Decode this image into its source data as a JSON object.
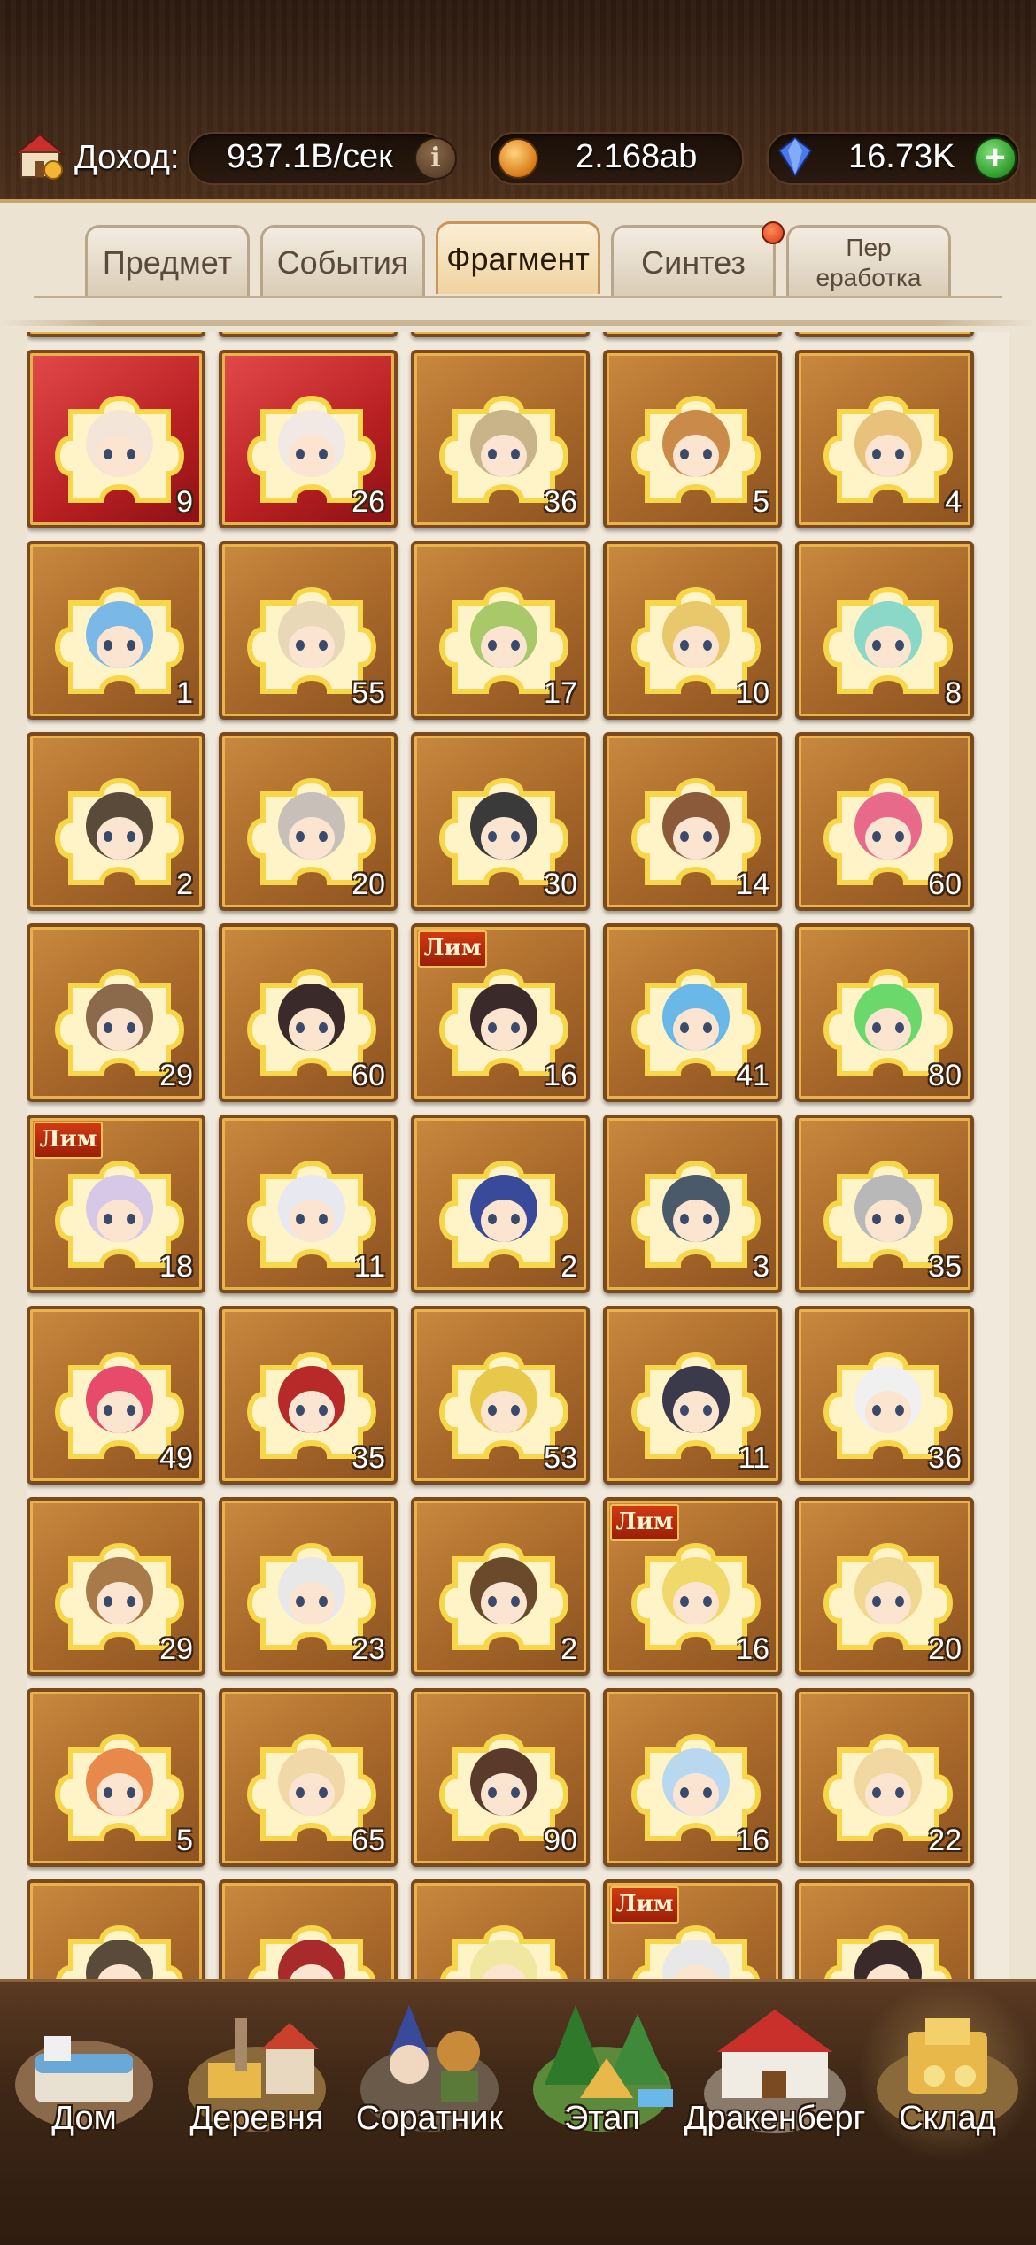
{
  "header": {
    "income_label": "Доход:",
    "income_value": "937.1B/сек",
    "coins_value": "2.168ab",
    "gems_value": "16.73K",
    "house_icon": "house-icon",
    "info_icon": "info-icon",
    "coin_icon": "coin-icon",
    "gem_icon": "gem-icon",
    "plus_icon": "plus-icon"
  },
  "tabs": [
    {
      "label": "Предмет"
    },
    {
      "label": "События"
    },
    {
      "label": "Фрагмент"
    },
    {
      "label": "Синтез"
    },
    {
      "label": "Пер\nеработка"
    }
  ],
  "active_tab": "Фрагмент",
  "lim_label": "Лим",
  "fragments": [
    {
      "count": "9",
      "bg": "red",
      "hue": "#f3e6d8"
    },
    {
      "count": "26",
      "bg": "red",
      "hue": "#f2e9e4"
    },
    {
      "count": "36",
      "bg": "gold",
      "hue": "#c9b48a"
    },
    {
      "count": "5",
      "bg": "gold",
      "hue": "#c98a4a"
    },
    {
      "count": "4",
      "bg": "gold",
      "hue": "#e8c27a"
    },
    {
      "count": "1",
      "bg": "gold",
      "hue": "#7ab8e8"
    },
    {
      "count": "55",
      "bg": "gold",
      "hue": "#e8d8b8"
    },
    {
      "count": "17",
      "bg": "gold",
      "hue": "#a8c86a"
    },
    {
      "count": "10",
      "bg": "gold",
      "hue": "#e8c86a"
    },
    {
      "count": "8",
      "bg": "gold",
      "hue": "#8ad8c8"
    },
    {
      "count": "2",
      "bg": "gold",
      "hue": "#5a4a3a"
    },
    {
      "count": "20",
      "bg": "gold",
      "hue": "#c8c0b8"
    },
    {
      "count": "30",
      "bg": "gold",
      "hue": "#3a3a3a"
    },
    {
      "count": "14",
      "bg": "gold",
      "hue": "#8a5a3a"
    },
    {
      "count": "60",
      "bg": "gold",
      "hue": "#e86a8a"
    },
    {
      "count": "29",
      "bg": "gold",
      "hue": "#8a6a4a"
    },
    {
      "count": "60",
      "bg": "gold",
      "hue": "#3a2a2a"
    },
    {
      "count": "16",
      "bg": "gold",
      "hue": "#3a2a2a",
      "lim": true
    },
    {
      "count": "41",
      "bg": "gold",
      "hue": "#6ab8e8"
    },
    {
      "count": "80",
      "bg": "gold",
      "hue": "#6ad86a"
    },
    {
      "count": "18",
      "bg": "gold",
      "hue": "#d8c8e8",
      "lim": true
    },
    {
      "count": "11",
      "bg": "gold",
      "hue": "#e8e8f0"
    },
    {
      "count": "2",
      "bg": "gold",
      "hue": "#3a4a9a"
    },
    {
      "count": "3",
      "bg": "gold",
      "hue": "#4a5a6a"
    },
    {
      "count": "35",
      "bg": "gold",
      "hue": "#b8b8b8"
    },
    {
      "count": "49",
      "bg": "gold",
      "hue": "#e84a6a"
    },
    {
      "count": "35",
      "bg": "gold",
      "hue": "#b82a2a"
    },
    {
      "count": "53",
      "bg": "gold",
      "hue": "#e8c84a"
    },
    {
      "count": "11",
      "bg": "gold",
      "hue": "#3a3a4a"
    },
    {
      "count": "36",
      "bg": "gold",
      "hue": "#f0f0f0"
    },
    {
      "count": "29",
      "bg": "gold",
      "hue": "#a87a4a"
    },
    {
      "count": "23",
      "bg": "gold",
      "hue": "#e8e8e8"
    },
    {
      "count": "2",
      "bg": "gold",
      "hue": "#6a4a2a"
    },
    {
      "count": "16",
      "bg": "gold",
      "hue": "#f0d86a",
      "lim": true
    },
    {
      "count": "20",
      "bg": "gold",
      "hue": "#f0d890"
    },
    {
      "count": "5",
      "bg": "gold",
      "hue": "#e8884a"
    },
    {
      "count": "65",
      "bg": "gold",
      "hue": "#f0d8a8"
    },
    {
      "count": "90",
      "bg": "gold",
      "hue": "#5a3a2a"
    },
    {
      "count": "16",
      "bg": "gold",
      "hue": "#b8d8f0"
    },
    {
      "count": "22",
      "bg": "gold",
      "hue": "#f0d8a0"
    },
    {
      "count": "",
      "bg": "gold",
      "hue": "#5a4a3a"
    },
    {
      "count": "",
      "bg": "gold",
      "hue": "#a82a2a"
    },
    {
      "count": "",
      "bg": "gold",
      "hue": "#f0e8a0"
    },
    {
      "count": "",
      "bg": "gold",
      "hue": "#e8e8e8",
      "lim": true
    },
    {
      "count": "",
      "bg": "gold",
      "hue": "#3a2a2a"
    }
  ],
  "nav": [
    {
      "label": "Дом",
      "icon": "bed-icon"
    },
    {
      "label": "Деревня",
      "icon": "village-icon"
    },
    {
      "label": "Соратник",
      "icon": "companion-icon"
    },
    {
      "label": "Этап",
      "icon": "camp-icon"
    },
    {
      "label": "Дракенберг",
      "icon": "castle-icon"
    },
    {
      "label": "Склад",
      "icon": "warehouse-icon",
      "active": true
    }
  ]
}
